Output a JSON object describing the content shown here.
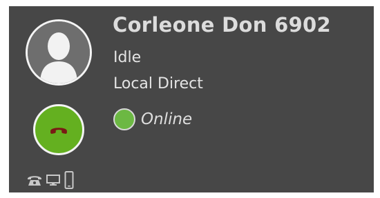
{
  "contact": {
    "name": "Corleone Don 6902",
    "status": "Idle",
    "route": "Local Direct",
    "presence": "Online"
  },
  "colors": {
    "card_background": "#474747",
    "call_button": "#64b020",
    "presence_online": "#6cb843"
  },
  "icons": {
    "avatar": "person-silhouette-icon",
    "call_button": "phone-hangup-icon",
    "devices": [
      "desk-phone-icon",
      "desktop-monitor-icon",
      "mobile-phone-icon"
    ]
  }
}
